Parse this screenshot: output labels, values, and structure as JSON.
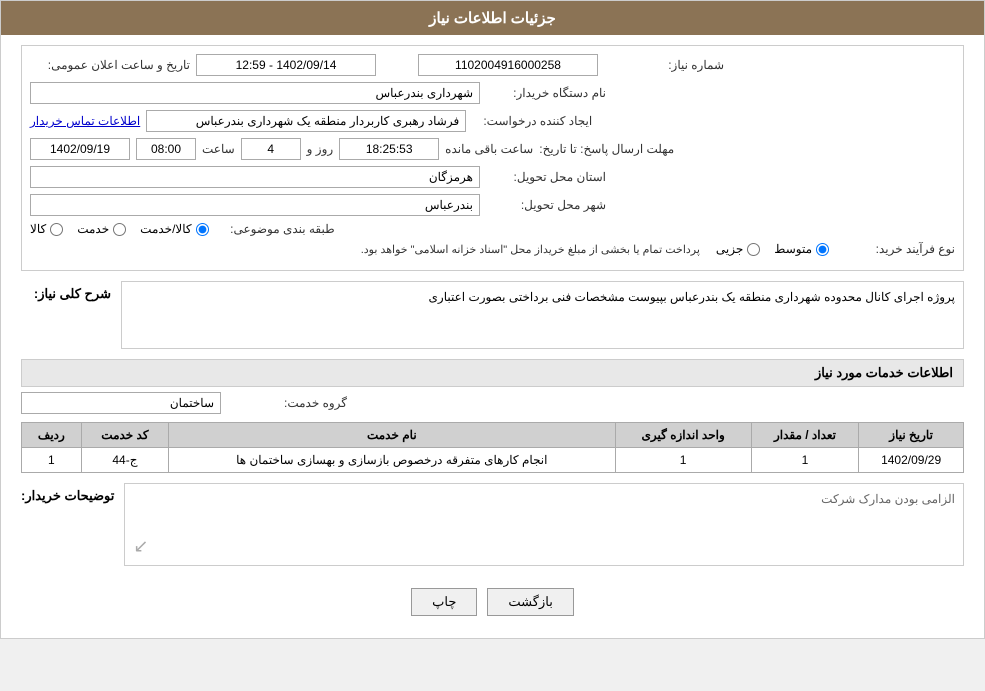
{
  "header": {
    "title": "جزئیات اطلاعات نیاز"
  },
  "fields": {
    "need_number_label": "شماره نیاز:",
    "need_number_value": "1102004916000258",
    "buyer_org_label": "نام دستگاه خریدار:",
    "buyer_org_value": "شهرداری بندرعباس",
    "requester_label": "ایجاد کننده درخواست:",
    "requester_value": "فرشاد رهبری کاربردار منطقه یک شهرداری بندرعباس",
    "contact_link": "اطلاعات تماس خریدار",
    "send_deadline_label": "مهلت ارسال پاسخ: تا تاریخ:",
    "deadline_date": "1402/09/19",
    "deadline_time_label": "ساعت",
    "deadline_time": "08:00",
    "remaining_days_label": "روز و",
    "remaining_days": "4",
    "remaining_time_label": "ساعت باقی مانده",
    "remaining_time": "18:25:53",
    "public_announce_label": "تاریخ و ساعت اعلان عمومی:",
    "public_announce_value": "1402/09/14 - 12:59",
    "province_label": "استان محل تحویل:",
    "province_value": "هرمزگان",
    "city_label": "شهر محل تحویل:",
    "city_value": "بندرعباس",
    "category_label": "طبقه بندی موضوعی:",
    "category_options": [
      "کالا",
      "خدمت",
      "کالا/خدمت"
    ],
    "category_selected": "کالا/خدمت",
    "purchase_type_label": "نوع فرآیند خرید:",
    "purchase_types": [
      "جزیی",
      "متوسط"
    ],
    "purchase_selected": "متوسط",
    "purchase_note": "پرداخت تمام یا بخشی از مبلغ خریداز محل \"اسناد خزانه اسلامی\" خواهد بود.",
    "need_description_label": "شرح کلی نیاز:",
    "need_description": "پروژه اجرای کانال محدوده شهرداری منطقه یک بندرعباس بپیوست مشخصات فنی برداختی بصورت اعتباری",
    "services_section_label": "اطلاعات خدمات مورد نیاز",
    "service_group_label": "گروه خدمت:",
    "service_group_value": "ساختمان",
    "table_headers": {
      "row_num": "ردیف",
      "service_code": "کد خدمت",
      "service_name": "نام خدمت",
      "unit": "واحد اندازه گیری",
      "quantity": "تعداد / مقدار",
      "need_date": "تاریخ نیاز"
    },
    "table_rows": [
      {
        "row_num": "1",
        "service_code": "ج-44",
        "service_name": "انجام کارهای متفرقه درخصوص بازسازی و بهسازی ساختمان ها",
        "unit": "1",
        "quantity": "1",
        "need_date": "1402/09/29"
      }
    ],
    "buyer_notes_label": "توضیحات خریدار:",
    "buyer_notes_text": "الزامی بودن مدارک شرکت"
  },
  "buttons": {
    "print": "چاپ",
    "back": "بازگشت"
  }
}
